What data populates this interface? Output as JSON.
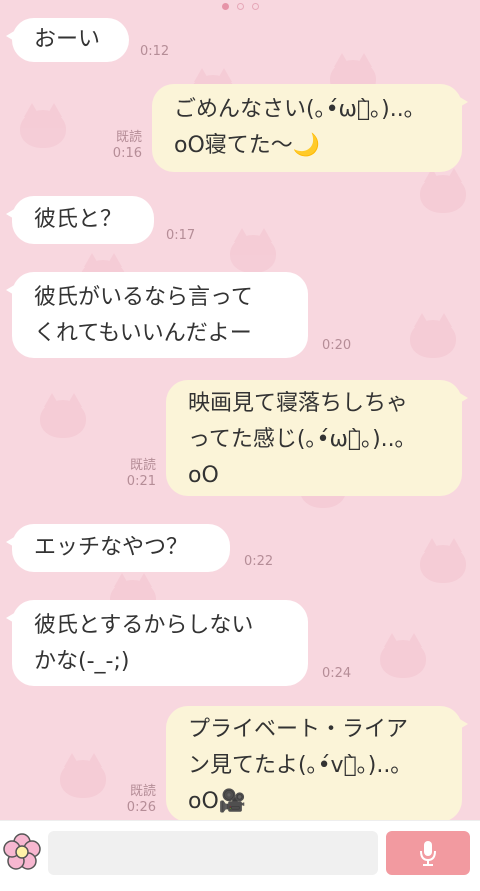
{
  "pagination": {
    "count": 3,
    "active": 0
  },
  "colors": {
    "background": "#f8d7df",
    "incoming": "#ffffff",
    "outgoing": "#fbf4d8",
    "mic": "#f29aa0"
  },
  "messages": [
    {
      "text": "おーい",
      "time": "0:12",
      "read": ""
    },
    {
      "text": "ごめんなさい(｡•́ωก̀｡)..｡\noO寝てた〜🌙",
      "time": "0:16",
      "read": "既読"
    },
    {
      "text": "彼氏と？",
      "time": "0:17",
      "read": ""
    },
    {
      "text": "彼氏がいるなら言って\nくれてもいいんだよー",
      "time": "0:20",
      "read": ""
    },
    {
      "text": "映画見て寝落ちしちゃ\nってた感じ(｡•́ωก̀｡)..｡\noO",
      "time": "0:21",
      "read": "既読"
    },
    {
      "text": "エッチなやつ？",
      "time": "0:22",
      "read": ""
    },
    {
      "text": "彼氏とするからしない\nかな(-_-;)",
      "time": "0:24",
      "read": ""
    },
    {
      "text": "プライベート・ライア\nン見てたよ(｡•́vก̀｡)..｡\noO🎥",
      "time": "0:26",
      "read": "既読"
    }
  ],
  "input": {
    "placeholder": "",
    "mic_icon": "microphone-icon",
    "sticker_icon": "flower-icon"
  }
}
